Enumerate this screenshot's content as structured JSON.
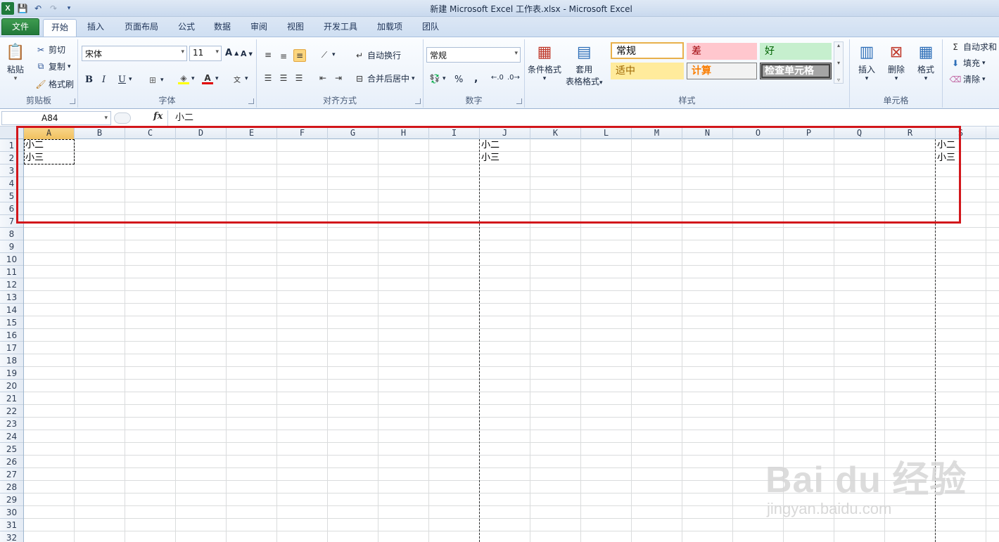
{
  "window": {
    "title": "新建 Microsoft Excel 工作表.xlsx - Microsoft Excel"
  },
  "tabs": [
    {
      "label": "文件",
      "active": false,
      "type": "file"
    },
    {
      "label": "开始",
      "active": true
    },
    {
      "label": "插入",
      "active": false
    },
    {
      "label": "页面布局",
      "active": false
    },
    {
      "label": "公式",
      "active": false
    },
    {
      "label": "数据",
      "active": false
    },
    {
      "label": "审阅",
      "active": false
    },
    {
      "label": "视图",
      "active": false
    },
    {
      "label": "开发工具",
      "active": false
    },
    {
      "label": "加载项",
      "active": false
    },
    {
      "label": "团队",
      "active": false
    }
  ],
  "ribbon": {
    "clipboard": {
      "label": "剪贴板",
      "paste": "粘贴",
      "cut": "剪切",
      "copy": "复制",
      "format_painter": "格式刷"
    },
    "font": {
      "label": "字体",
      "name": "宋体",
      "size": "11",
      "bold": "B",
      "italic": "I",
      "underline": "U"
    },
    "alignment": {
      "label": "对齐方式",
      "wrap": "自动换行",
      "merge": "合并后居中"
    },
    "number": {
      "label": "数字",
      "format": "常规",
      "percent": "%",
      "comma": ","
    },
    "styles": {
      "label": "样式",
      "conditional": "条件格式",
      "table_line1": "套用",
      "table_line2": "表格格式",
      "gallery": [
        {
          "text": "常规",
          "bg": "#ffffff",
          "fg": "#000000",
          "border": "#e8b04b"
        },
        {
          "text": "差",
          "bg": "#ffc7ce",
          "fg": "#9c0006",
          "border": "#ffc7ce"
        },
        {
          "text": "好",
          "bg": "#c6efce",
          "fg": "#006100",
          "border": "#c6efce"
        },
        {
          "text": "适中",
          "bg": "#ffeb9c",
          "fg": "#9c6500",
          "border": "#ffeb9c"
        },
        {
          "text": "计算",
          "bg": "#f2f2f2",
          "fg": "#fa7d00",
          "border": "#7f7f7f"
        },
        {
          "text": "检查单元格",
          "bg": "#a5a5a5",
          "fg": "#ffffff",
          "border": "#3f3f3f"
        }
      ]
    },
    "cells": {
      "label": "单元格",
      "insert": "插入",
      "delete": "删除",
      "format": "格式"
    },
    "editing": {
      "autosum": "自动求和",
      "fill": "填充",
      "clear": "清除"
    }
  },
  "formula_bar": {
    "name_box": "A84",
    "fx": "fx",
    "content": "小二"
  },
  "sheet": {
    "columns": [
      "A",
      "B",
      "C",
      "D",
      "E",
      "F",
      "G",
      "H",
      "I",
      "J",
      "K",
      "L",
      "M",
      "N",
      "O",
      "P",
      "Q",
      "R",
      "S"
    ],
    "selected_column": "A",
    "rows": [
      "1",
      "2",
      "3",
      "4",
      "5",
      "6",
      "7",
      "8",
      "9",
      "10",
      "11",
      "12",
      "13",
      "14",
      "15",
      "16",
      "17",
      "18",
      "19",
      "20",
      "21",
      "22",
      "23",
      "24",
      "25",
      "26",
      "27",
      "28",
      "29",
      "30",
      "31",
      "32"
    ],
    "cells": [
      {
        "ref": "A1",
        "text": "小二"
      },
      {
        "ref": "A2",
        "text": "小三"
      },
      {
        "ref": "J1",
        "text": "小二"
      },
      {
        "ref": "J2",
        "text": "小三"
      },
      {
        "ref": "S1",
        "text": "小二"
      },
      {
        "ref": "S2",
        "text": "小三"
      }
    ]
  },
  "watermark": {
    "brand": "Bai du 经验",
    "url": "jingyan.baidu.com"
  }
}
